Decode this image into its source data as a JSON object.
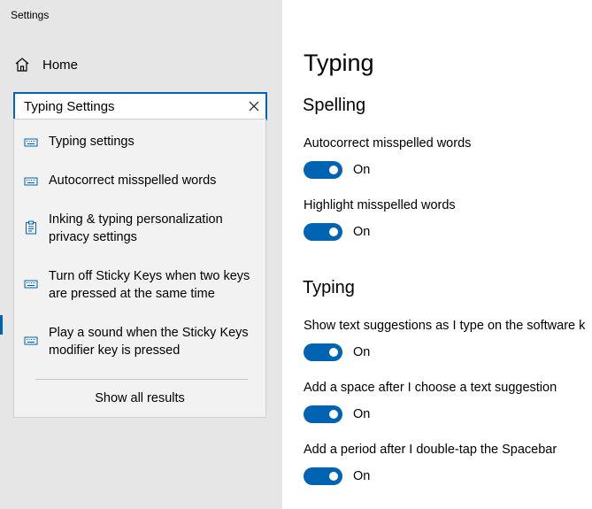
{
  "app": {
    "title": "Settings"
  },
  "sidebar": {
    "home_label": "Home",
    "search": {
      "value": "Typing Settings",
      "clear_icon": "close-icon"
    },
    "suggestions": [
      {
        "icon": "keyboard-icon",
        "label": "Typing settings"
      },
      {
        "icon": "keyboard-icon",
        "label": "Autocorrect misspelled words"
      },
      {
        "icon": "clipboard-icon",
        "label": "Inking & typing personalization privacy settings"
      },
      {
        "icon": "keyboard-icon",
        "label": "Turn off Sticky Keys when two keys are pressed at the same time"
      },
      {
        "icon": "keyboard-icon",
        "label": "Play a sound when the Sticky Keys modifier key is pressed"
      }
    ],
    "show_all_label": "Show all results"
  },
  "main": {
    "title": "Typing",
    "sections": [
      {
        "title": "Spelling",
        "settings": [
          {
            "label": "Autocorrect misspelled words",
            "state": "On"
          },
          {
            "label": "Highlight misspelled words",
            "state": "On"
          }
        ]
      },
      {
        "title": "Typing",
        "settings": [
          {
            "label": "Show text suggestions as I type on the software k",
            "state": "On"
          },
          {
            "label": "Add a space after I choose a text suggestion",
            "state": "On"
          },
          {
            "label": "Add a period after I double-tap the Spacebar",
            "state": "On"
          }
        ]
      }
    ]
  },
  "colors": {
    "accent": "#0063b1",
    "sidebar_bg": "#e6e6e6",
    "dropdown_bg": "#f2f2f2"
  }
}
